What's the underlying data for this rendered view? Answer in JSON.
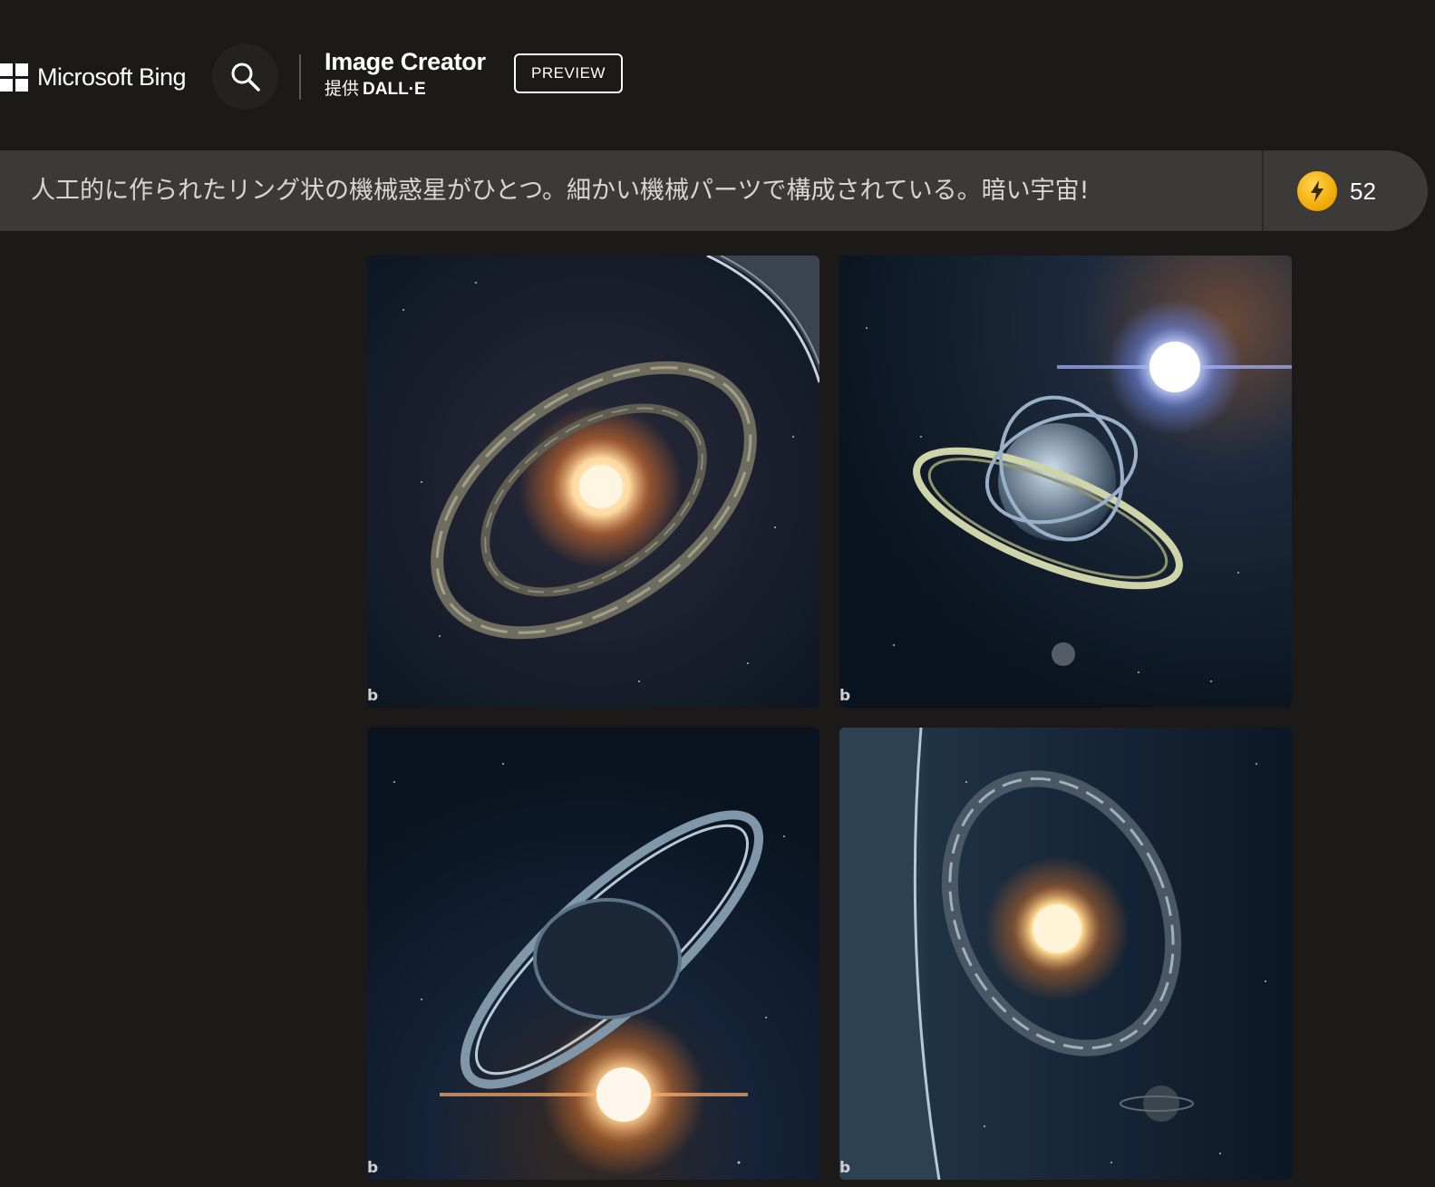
{
  "header": {
    "brand_label": "Microsoft Bing",
    "app_title": "Image Creator",
    "provider_prefix": "提供",
    "provider_name": "DALL·E",
    "badge": "PREVIEW",
    "search_icon": "search-icon"
  },
  "prompt": {
    "text": "人工的に作られたリング状の機械惑星がひとつ。細かい機械パーツで構成されている。暗い宇宙!",
    "coin_icon": "boost-coin-icon",
    "boost_count": "52"
  },
  "results": {
    "images": [
      {
        "watermark": "b"
      },
      {
        "watermark": "b"
      },
      {
        "watermark": "b"
      },
      {
        "watermark": "b"
      }
    ]
  },
  "colors": {
    "background": "#1b1a19",
    "prompt_bar": "#3b3a39",
    "coin": "#f0a500"
  }
}
